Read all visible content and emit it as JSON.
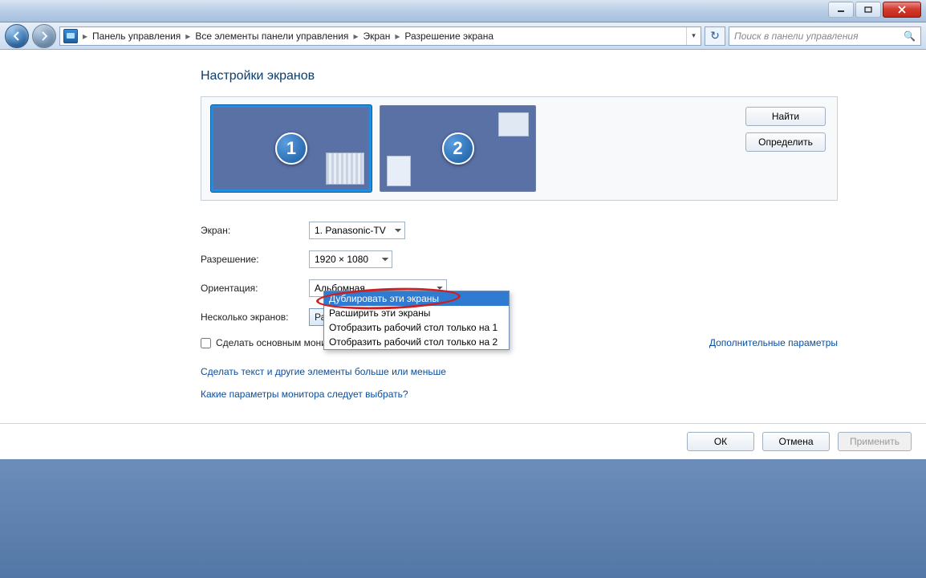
{
  "breadcrumbs": [
    "Панель управления",
    "Все элементы панели управления",
    "Экран",
    "Разрешение экрана"
  ],
  "search": {
    "placeholder": "Поиск в панели управления"
  },
  "page_title": "Настройки экранов",
  "monitors": {
    "selected": "1",
    "other": "2"
  },
  "pane_buttons": {
    "find": "Найти",
    "identify": "Определить"
  },
  "labels": {
    "screen": "Экран:",
    "resolution": "Разрешение:",
    "orientation": "Ориентация:",
    "multi": "Несколько экранов:",
    "make_primary": "Сделать основным монитором"
  },
  "values": {
    "screen": "1. Panasonic-TV",
    "resolution": "1920 × 1080",
    "orientation": "Альбомная",
    "multi": "Расширить эти экраны"
  },
  "multi_options": [
    "Дублировать эти экраны",
    "Расширить эти экраны",
    "Отобразить рабочий стол только на 1",
    "Отобразить рабочий стол только на 2"
  ],
  "adv_link": "Дополнительные параметры",
  "links": [
    "Сделать текст и другие элементы больше или меньше",
    "Какие параметры монитора следует выбрать?"
  ],
  "buttons": {
    "ok": "ОК",
    "cancel": "Отмена",
    "apply": "Применить"
  }
}
